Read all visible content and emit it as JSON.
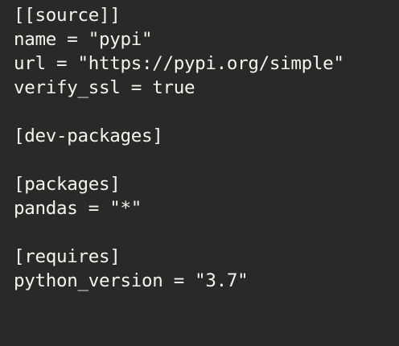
{
  "editor": {
    "lines": [
      "[[source]]",
      "name = \"pypi\"",
      "url = \"https://pypi.org/simple\"",
      "verify_ssl = true",
      "",
      "[dev-packages]",
      "",
      "[packages]",
      "pandas = \"*\"",
      "",
      "[requires]",
      "python_version = \"3.7\""
    ]
  },
  "colors": {
    "background": "#282a28",
    "text": "#f4f4ef"
  }
}
